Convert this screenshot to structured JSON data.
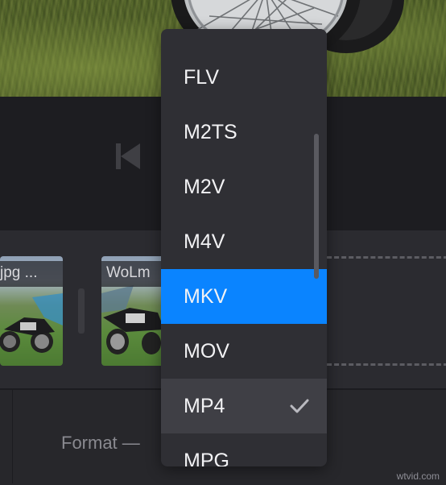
{
  "menu": {
    "items": [
      {
        "label": "FLV",
        "state": "normal"
      },
      {
        "label": "M2TS",
        "state": "normal"
      },
      {
        "label": "M2V",
        "state": "normal"
      },
      {
        "label": "M4V",
        "state": "normal"
      },
      {
        "label": "MKV",
        "state": "highlighted"
      },
      {
        "label": "MOV",
        "state": "normal"
      },
      {
        "label": "MP4",
        "state": "selected"
      },
      {
        "label": "MPG",
        "state": "normal"
      }
    ],
    "selected_value": "MP4",
    "highlighted_value": "MKV",
    "check_icon": "checkmark-icon"
  },
  "timeline": {
    "clips": [
      {
        "name": "jpg ..."
      },
      {
        "name": "WoLm"
      }
    ]
  },
  "settings": {
    "format_label": "Format —"
  },
  "player": {
    "prev_icon": "skip-previous-icon"
  },
  "watermark": "wtvid.com",
  "colors": {
    "highlight": "#0a84ff",
    "menu_bg": "#2f2f34",
    "selected_bg": "#3f3f45",
    "app_bg": "#27272b"
  }
}
